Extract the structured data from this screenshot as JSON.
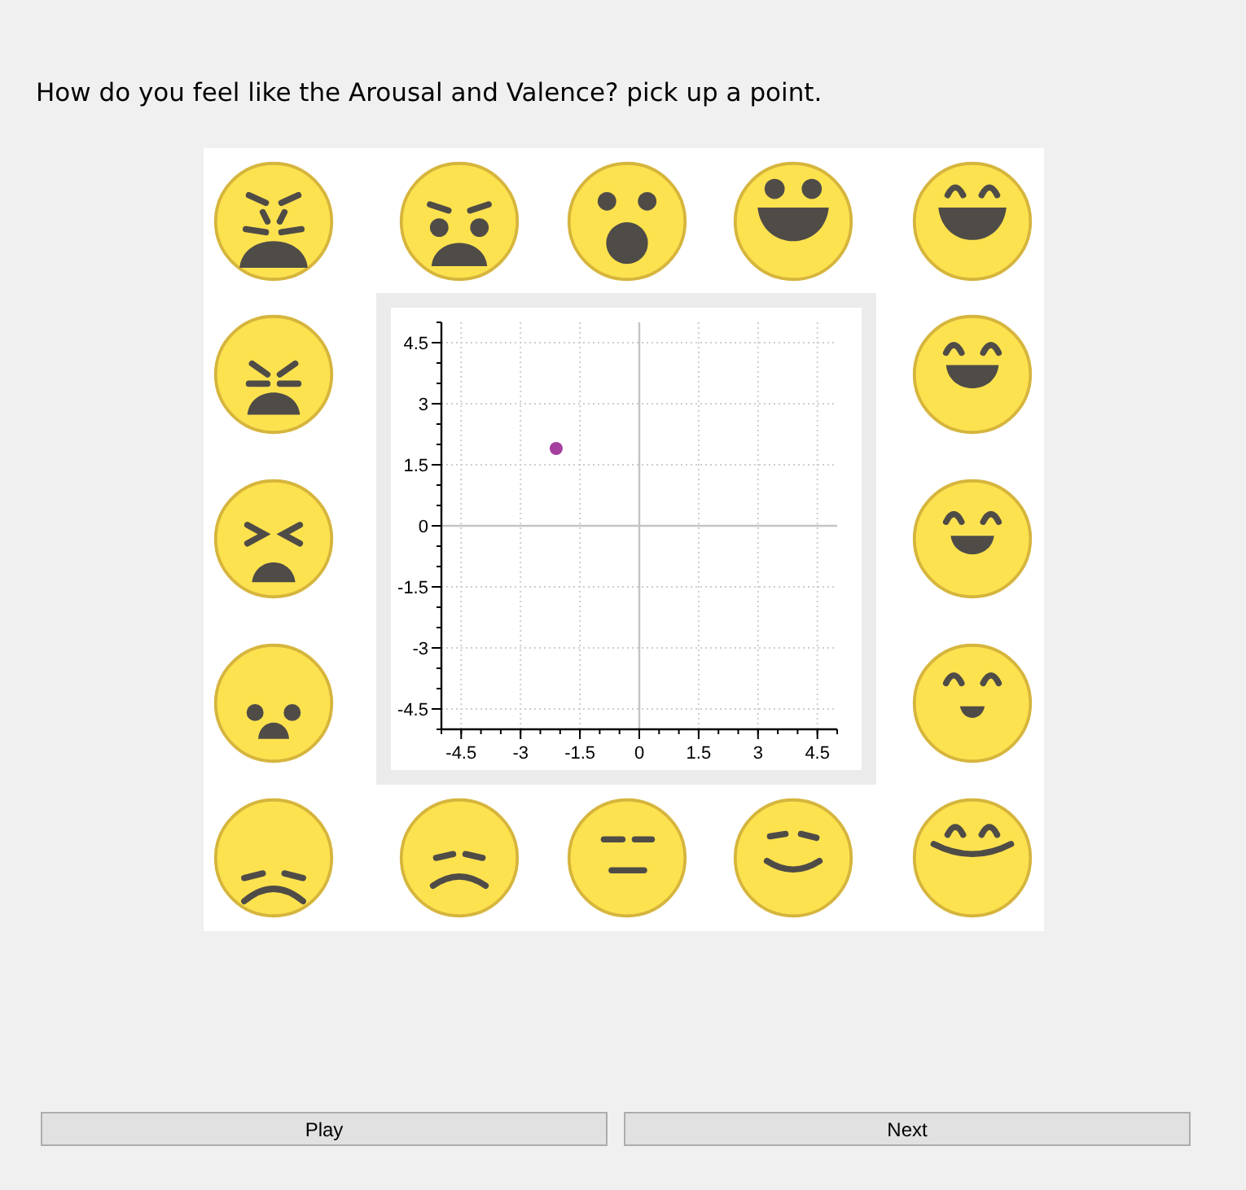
{
  "question": "How do you feel like the Arousal and Valence? pick up a point.",
  "emotion_board": {
    "faces": [
      {
        "kind": "furious"
      },
      {
        "kind": "angry"
      },
      {
        "kind": "astonished"
      },
      {
        "kind": "excited"
      },
      {
        "kind": "laughing"
      },
      {
        "kind": "anguished"
      },
      {
        "kind": "beaming"
      },
      {
        "kind": "tormented"
      },
      {
        "kind": "cheerful"
      },
      {
        "kind": "worried"
      },
      {
        "kind": "happy"
      },
      {
        "kind": "sad"
      },
      {
        "kind": "unhappy"
      },
      {
        "kind": "neutral"
      },
      {
        "kind": "content"
      },
      {
        "kind": "blissful"
      }
    ],
    "chart": {
      "chart_data": {
        "type": "scatter",
        "x": [
          -2.1
        ],
        "series": [
          {
            "color": "#a43f9f",
            "values": [
              1.9
            ]
          }
        ],
        "xlim": [
          -5,
          5
        ],
        "ylim": [
          -5,
          5
        ],
        "xticks": [
          -4.5,
          -3,
          -1.5,
          0,
          1.5,
          3,
          4.5
        ],
        "yticks": [
          -4.5,
          -3,
          -1.5,
          0,
          1.5,
          3,
          4.5
        ],
        "grid": true
      }
    }
  },
  "buttons": [
    {
      "label": "Play"
    },
    {
      "label": "Next"
    }
  ]
}
